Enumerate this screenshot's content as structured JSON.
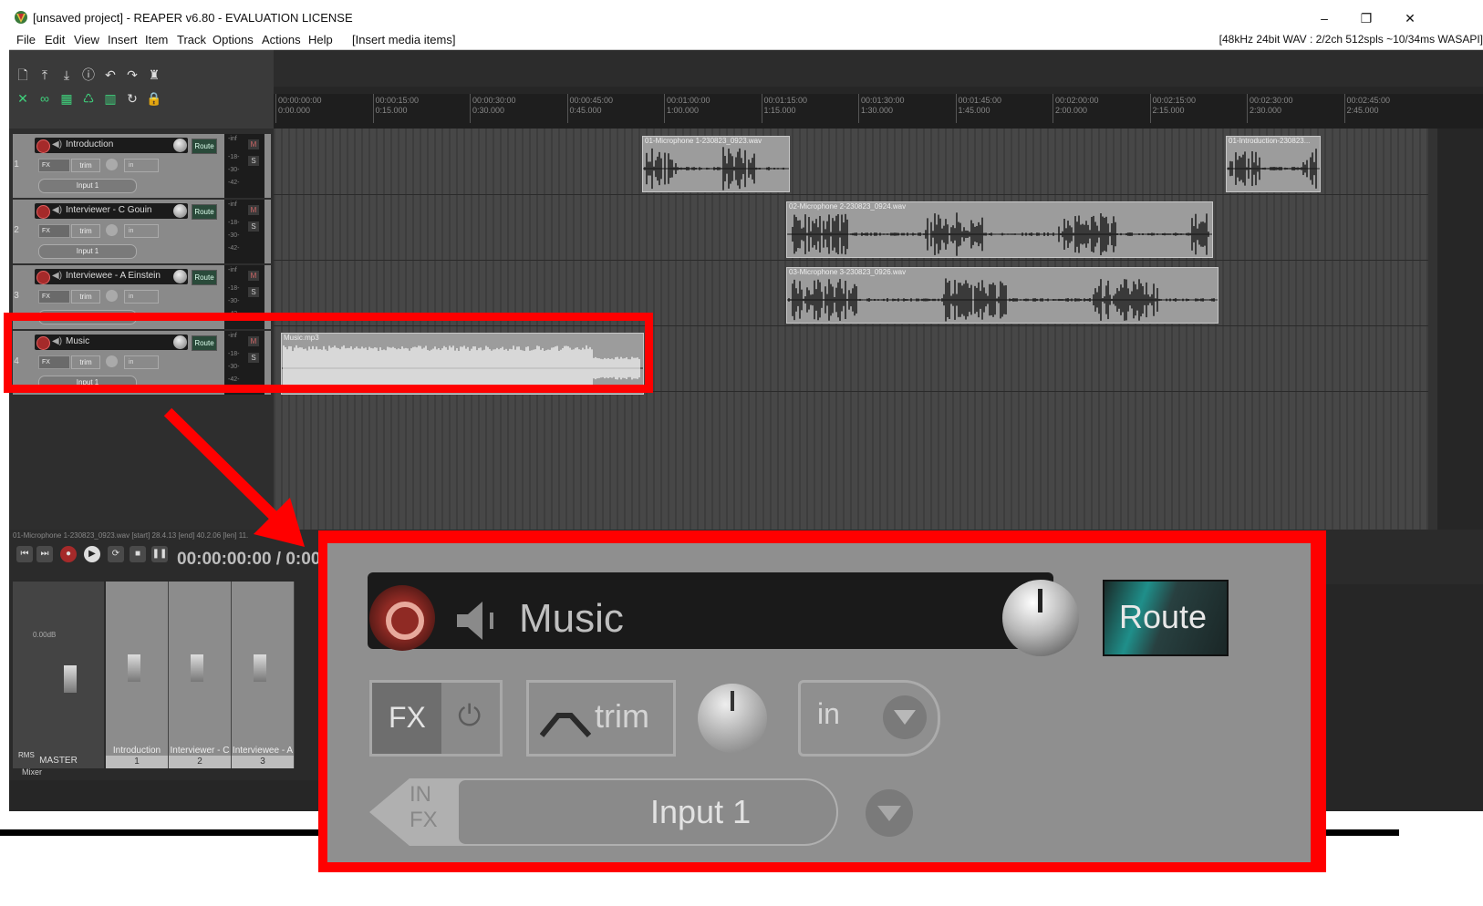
{
  "window": {
    "title": "[unsaved project] - REAPER v6.80 - EVALUATION LICENSE",
    "minimize": "–",
    "restore": "❐",
    "close": "✕"
  },
  "menu": {
    "items": [
      "File",
      "Edit",
      "View",
      "Insert",
      "Item",
      "Track",
      "Options",
      "Actions",
      "Help",
      "[Insert media items]"
    ],
    "audio_info": "[48kHz 24bit WAV : 2/2ch 512spls ~10/34ms WASAPI]"
  },
  "ruler": {
    "labels": [
      [
        "00:00:00:00",
        "0:00.000"
      ],
      [
        "00:00:15:00",
        "0:15.000"
      ],
      [
        "00:00:30:00",
        "0:30.000"
      ],
      [
        "00:00:45:00",
        "0:45.000"
      ],
      [
        "00:01:00:00",
        "1:00.000"
      ],
      [
        "00:01:15:00",
        "1:15.000"
      ],
      [
        "00:01:30:00",
        "1:30.000"
      ],
      [
        "00:01:45:00",
        "1:45.000"
      ],
      [
        "00:02:00:00",
        "2:00.000"
      ],
      [
        "00:02:15:00",
        "2:15.000"
      ],
      [
        "00:02:30:00",
        "2:30.000"
      ],
      [
        "00:02:45:00",
        "2:45.000"
      ]
    ]
  },
  "tracks": [
    {
      "num": "1",
      "name": "Introduction",
      "route": "Route",
      "fx": "FX",
      "trim": "trim",
      "in": "in",
      "input": "Input 1"
    },
    {
      "num": "2",
      "name": "Interviewer - C Gouin",
      "route": "Route",
      "fx": "FX",
      "trim": "trim",
      "in": "in",
      "input": "Input 1"
    },
    {
      "num": "3",
      "name": "Interviewee - A Einstein",
      "route": "Route",
      "fx": "FX",
      "trim": "trim",
      "in": "in",
      "input": "Input 1"
    },
    {
      "num": "4",
      "name": "Music",
      "route": "Route",
      "fx": "FX",
      "trim": "trim",
      "in": "in",
      "input": "Input 1"
    }
  ],
  "meter_labels": {
    "inf": "-inf",
    "m": "M",
    "s": "S",
    "db": [
      "-18-",
      "-30-",
      "-42-",
      "-54-"
    ]
  },
  "items": {
    "intro_a": "01-Microphone 1-230823_0923.wav",
    "intro_b": "01-Introduction-230823...",
    "mic2": "02-Microphone 2-230823_0924.wav",
    "mic3": "03-Microphone 3-230823_0926.wav",
    "music": "Music.mp3"
  },
  "transport": {
    "status": "01-Microphone 1-230823_0923.wav [start] 28.4.13 [end] 40.2.06 [len] 11.",
    "timecode": "00:00:00:00 / 0:00"
  },
  "mixer": {
    "master_label": "MASTER",
    "master_db": "0.00dB",
    "rms": "RMS",
    "strips": [
      {
        "name": "Introduction",
        "num": "1"
      },
      {
        "name": "Interviewer - C",
        "num": "2"
      },
      {
        "name": "Interviewee - A",
        "num": "3"
      }
    ],
    "tab": "Mixer"
  },
  "zoom": {
    "track_name": "Music",
    "route": "Route",
    "fx": "FX",
    "trim": "trim",
    "in": "in",
    "in_fx": [
      "IN",
      "FX"
    ],
    "input": "Input 1"
  },
  "colors": {
    "highlight": "#ff0000",
    "record_arm": "#a52a2a",
    "route_accent": "#1f8f8a"
  }
}
